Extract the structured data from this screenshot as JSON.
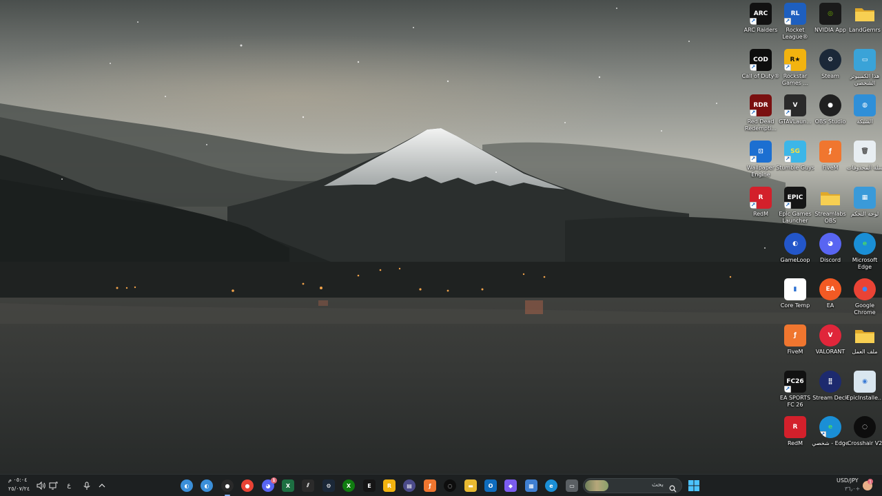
{
  "desktop": {
    "icons": [
      {
        "id": "arc-raiders",
        "label": "ARC Raiders",
        "col": 0,
        "row": 0,
        "bg": "#111111",
        "glyph": "ARC",
        "fg": "#ffffff",
        "shortcut": true,
        "icon": "arc-raiders-icon"
      },
      {
        "id": "rocket-league",
        "label": "Rocket League®",
        "col": 1,
        "row": 0,
        "bg": "#1e5fbf",
        "glyph": "RL",
        "fg": "#ffffff",
        "shortcut": true,
        "icon": "rocket-league-icon"
      },
      {
        "id": "nvidia-app",
        "label": "NVIDIA App",
        "col": 2,
        "row": 0,
        "bg": "#1a1a1a",
        "glyph": "◎",
        "fg": "#76b900",
        "shortcut": false,
        "icon": "nvidia-icon"
      },
      {
        "id": "landgemrs",
        "label": "LandGemrs",
        "col": 3,
        "row": 0,
        "bg": "#e8b931",
        "glyph": "",
        "fg": "#ffffff",
        "shortcut": false,
        "icon": "folder-icon"
      },
      {
        "id": "call-of-duty",
        "label": "Call of Duty®",
        "col": 0,
        "row": 1,
        "bg": "#0d0d0d",
        "glyph": "COD",
        "fg": "#ffffff",
        "shortcut": true,
        "icon": "call-of-duty-icon"
      },
      {
        "id": "rockstar",
        "label": "Rockstar Games ...",
        "col": 1,
        "row": 1,
        "bg": "#f2b30f",
        "glyph": "R★",
        "fg": "#111111",
        "shortcut": true,
        "icon": "rockstar-icon"
      },
      {
        "id": "steam",
        "label": "Steam",
        "col": 2,
        "row": 1,
        "bg": "#1b2838",
        "glyph": "⚙",
        "fg": "#ffffff",
        "shortcut": false,
        "icon": "steam-icon",
        "round": true
      },
      {
        "id": "this-pc",
        "label": "هذا الكمبيوتر الشخصي",
        "col": 3,
        "row": 1,
        "bg": "#3aa3d8",
        "glyph": "▭",
        "fg": "#ffffff",
        "shortcut": false,
        "icon": "computer-icon"
      },
      {
        "id": "red-dead",
        "label": "Red Dead Redempti...",
        "col": 0,
        "row": 2,
        "bg": "#7a1010",
        "glyph": "RDR",
        "fg": "#ffffff",
        "shortcut": true,
        "icon": "red-dead-icon"
      },
      {
        "id": "gtav-launcher",
        "label": "GTAVLaun...",
        "col": 1,
        "row": 2,
        "bg": "#2a2a2a",
        "glyph": "V",
        "fg": "#ffffff",
        "shortcut": true,
        "icon": "gtav-icon"
      },
      {
        "id": "obs-studio",
        "label": "OBS Studio",
        "col": 2,
        "row": 2,
        "bg": "#202020",
        "glyph": "●",
        "fg": "#ffffff",
        "shortcut": false,
        "icon": "obs-icon",
        "round": true
      },
      {
        "id": "network",
        "label": "الشبكة",
        "col": 3,
        "row": 2,
        "bg": "#2f8fd8",
        "glyph": "◍",
        "fg": "#ffffff",
        "shortcut": false,
        "icon": "network-icon"
      },
      {
        "id": "wallpaper-engine",
        "label": "Wallpaper Engine",
        "col": 0,
        "row": 3,
        "bg": "#1c6fd1",
        "glyph": "⊡",
        "fg": "#ffffff",
        "shortcut": true,
        "icon": "wallpaper-engine-icon"
      },
      {
        "id": "stumble-guys",
        "label": "Stumble Guys",
        "col": 1,
        "row": 3,
        "bg": "#3cb6e8",
        "glyph": "SG",
        "fg": "#ffdf3a",
        "shortcut": true,
        "icon": "stumble-guys-icon"
      },
      {
        "id": "fivem-1",
        "label": "FiveM",
        "col": 2,
        "row": 3,
        "bg": "#f0762f",
        "glyph": "ƒ",
        "fg": "#ffffff",
        "shortcut": false,
        "icon": "fivem-icon"
      },
      {
        "id": "recycle-bin",
        "label": "سلة المحذوفات",
        "col": 3,
        "row": 3,
        "bg": "#e8eef2",
        "glyph": "🗑",
        "fg": "#555555",
        "shortcut": false,
        "icon": "recycle-bin-icon"
      },
      {
        "id": "redm-1",
        "label": "RedM",
        "col": 0,
        "row": 4,
        "bg": "#d3202b",
        "glyph": "R",
        "fg": "#ffffff",
        "shortcut": true,
        "icon": "redm-icon"
      },
      {
        "id": "epic-games",
        "label": "Epic Games Launcher",
        "col": 1,
        "row": 4,
        "bg": "#151515",
        "glyph": "EPIC",
        "fg": "#ffffff",
        "shortcut": true,
        "icon": "epic-games-icon"
      },
      {
        "id": "streamlabs-obs",
        "label": "Streamlabs OBS",
        "col": 2,
        "row": 4,
        "bg": "#e8b931",
        "glyph": "",
        "fg": "#ffffff",
        "shortcut": false,
        "icon": "folder-icon"
      },
      {
        "id": "control-panel",
        "label": "لوحة التحكم",
        "col": 3,
        "row": 4,
        "bg": "#3a9ad9",
        "glyph": "▦",
        "fg": "#ffffff",
        "shortcut": false,
        "icon": "control-panel-icon"
      },
      {
        "id": "gameloop",
        "label": "GameLoop",
        "col": 1,
        "row": 5,
        "bg": "#2356c9",
        "glyph": "◐",
        "fg": "#ffffff",
        "shortcut": false,
        "icon": "gameloop-icon",
        "round": true
      },
      {
        "id": "discord",
        "label": "Discord",
        "col": 2,
        "row": 5,
        "bg": "#5865f2",
        "glyph": "◕",
        "fg": "#ffffff",
        "shortcut": false,
        "icon": "discord-icon",
        "round": true
      },
      {
        "id": "microsoft-edge",
        "label": "Microsoft Edge",
        "col": 3,
        "row": 5,
        "bg": "#1a8fd6",
        "glyph": "e",
        "fg": "#4cd964",
        "shortcut": false,
        "icon": "edge-icon",
        "round": true
      },
      {
        "id": "core-temp",
        "label": "Core Temp",
        "col": 1,
        "row": 6,
        "bg": "#ffffff",
        "glyph": "▮",
        "fg": "#2a6fd1",
        "shortcut": false,
        "icon": "core-temp-icon"
      },
      {
        "id": "ea",
        "label": "EA",
        "col": 2,
        "row": 6,
        "bg": "#f25a24",
        "glyph": "EA",
        "fg": "#ffffff",
        "shortcut": false,
        "icon": "ea-icon",
        "round": true
      },
      {
        "id": "google-chrome",
        "label": "Google Chrome",
        "col": 3,
        "row": 6,
        "bg": "#ea4335",
        "glyph": "●",
        "fg": "#4285f4",
        "shortcut": false,
        "icon": "chrome-icon",
        "round": true
      },
      {
        "id": "fivem-2",
        "label": "FiveM",
        "col": 1,
        "row": 7,
        "bg": "#f0762f",
        "glyph": "ƒ",
        "fg": "#ffffff",
        "shortcut": false,
        "icon": "fivem-icon"
      },
      {
        "id": "valorant",
        "label": "VALORANT",
        "col": 2,
        "row": 7,
        "bg": "#e0263a",
        "glyph": "V",
        "fg": "#ffffff",
        "shortcut": false,
        "icon": "valorant-icon",
        "round": true
      },
      {
        "id": "work-folder",
        "label": "ملف العمل",
        "col": 3,
        "row": 7,
        "bg": "#e8b931",
        "glyph": "",
        "fg": "#ffffff",
        "shortcut": false,
        "icon": "folder-icon"
      },
      {
        "id": "ea-fc-26",
        "label": "EA SPORTS FC 26",
        "col": 1,
        "row": 8,
        "bg": "#111111",
        "glyph": "FC26",
        "fg": "#ffffff",
        "shortcut": true,
        "icon": "ea-fc-icon"
      },
      {
        "id": "stream-deck",
        "label": "Stream Deck",
        "col": 2,
        "row": 8,
        "bg": "#1d2a6e",
        "glyph": "⣿",
        "fg": "#ffffff",
        "shortcut": false,
        "icon": "stream-deck-icon",
        "round": true
      },
      {
        "id": "epic-installer",
        "label": "EpicInstalle...",
        "col": 3,
        "row": 8,
        "bg": "#d9e6ef",
        "glyph": "◉",
        "fg": "#3a7bd5",
        "shortcut": false,
        "icon": "installer-icon"
      },
      {
        "id": "redm-2",
        "label": "RedM",
        "col": 1,
        "row": 9,
        "bg": "#d3202b",
        "glyph": "R",
        "fg": "#ffffff",
        "shortcut": false,
        "icon": "redm-icon"
      },
      {
        "id": "edge-personal",
        "label": "شخصي - Edge",
        "col": 2,
        "row": 9,
        "bg": "#1a8fd6",
        "glyph": "e",
        "fg": "#4cd964",
        "shortcut": true,
        "icon": "edge-icon",
        "round": true
      },
      {
        "id": "crosshair-v2",
        "label": "Crosshair V2",
        "col": 3,
        "row": 9,
        "bg": "#0d0d0d",
        "glyph": "◌",
        "fg": "#ffffff",
        "shortcut": false,
        "icon": "crosshair-icon",
        "round": true
      }
    ]
  },
  "taskbar": {
    "clock_time": "٠٥:٠٤ م",
    "clock_date": "٢٥/٠٧/٢٤",
    "language": "ع",
    "search_placeholder": "بحث",
    "widget_title": "USD/JPY",
    "widget_value": "٣٦٫٠+",
    "apps": [
      {
        "id": "app-blue-1",
        "bg": "#3b8fd9",
        "glyph": "◐",
        "round": true,
        "icon": "gameloop-icon"
      },
      {
        "id": "app-blue-2",
        "bg": "#3b8fd9",
        "glyph": "◐",
        "round": true,
        "icon": "gameloop-icon"
      },
      {
        "id": "app-obs",
        "bg": "#2a2a2a",
        "glyph": "●",
        "round": true,
        "icon": "obs-icon",
        "active": true
      },
      {
        "id": "app-chrome",
        "bg": "#ea4335",
        "glyph": "●",
        "round": true,
        "icon": "chrome-icon"
      },
      {
        "id": "app-discord",
        "bg": "#5865f2",
        "glyph": "◕",
        "round": true,
        "icon": "discord-icon",
        "badge": "1"
      },
      {
        "id": "app-excel",
        "bg": "#1d6f42",
        "glyph": "X",
        "round": false,
        "icon": "excel-icon"
      },
      {
        "id": "app-stripes",
        "bg": "#2b2b2b",
        "glyph": "⫽",
        "round": false,
        "icon": "app-icon"
      },
      {
        "id": "app-steam",
        "bg": "#1b2838",
        "glyph": "⚙",
        "round": false,
        "icon": "steam-icon"
      },
      {
        "id": "app-xbox",
        "bg": "#107c10",
        "glyph": "X",
        "round": true,
        "icon": "xbox-icon"
      },
      {
        "id": "app-epic",
        "bg": "#151515",
        "glyph": "E",
        "round": false,
        "icon": "epic-games-icon"
      },
      {
        "id": "app-rockstar",
        "bg": "#f2b30f",
        "glyph": "R",
        "round": false,
        "icon": "rockstar-icon"
      },
      {
        "id": "app-purple",
        "bg": "#4b4b8a",
        "glyph": "▤",
        "round": true,
        "icon": "app-icon"
      },
      {
        "id": "app-fivem",
        "bg": "#f0762f",
        "glyph": "ƒ",
        "round": false,
        "icon": "fivem-icon"
      },
      {
        "id": "app-crosshair",
        "bg": "#0d0d0d",
        "glyph": "◌",
        "round": true,
        "icon": "crosshair-icon"
      },
      {
        "id": "app-explorer",
        "bg": "#e8b931",
        "glyph": "▬",
        "round": false,
        "icon": "file-explorer-icon"
      },
      {
        "id": "app-outlook",
        "bg": "#0f6cbd",
        "glyph": "O",
        "round": false,
        "icon": "outlook-icon"
      },
      {
        "id": "app-copilot",
        "bg": "#7b5cf0",
        "glyph": "◆",
        "round": false,
        "icon": "copilot-icon"
      },
      {
        "id": "app-store",
        "bg": "#3f7fd1",
        "glyph": "▦",
        "round": false,
        "icon": "store-icon"
      },
      {
        "id": "app-edge",
        "bg": "#1a8fd6",
        "glyph": "e",
        "round": true,
        "icon": "edge-icon"
      },
      {
        "id": "app-taskview",
        "bg": "#5a5f63",
        "glyph": "▭",
        "round": false,
        "icon": "task-view-icon"
      }
    ]
  }
}
